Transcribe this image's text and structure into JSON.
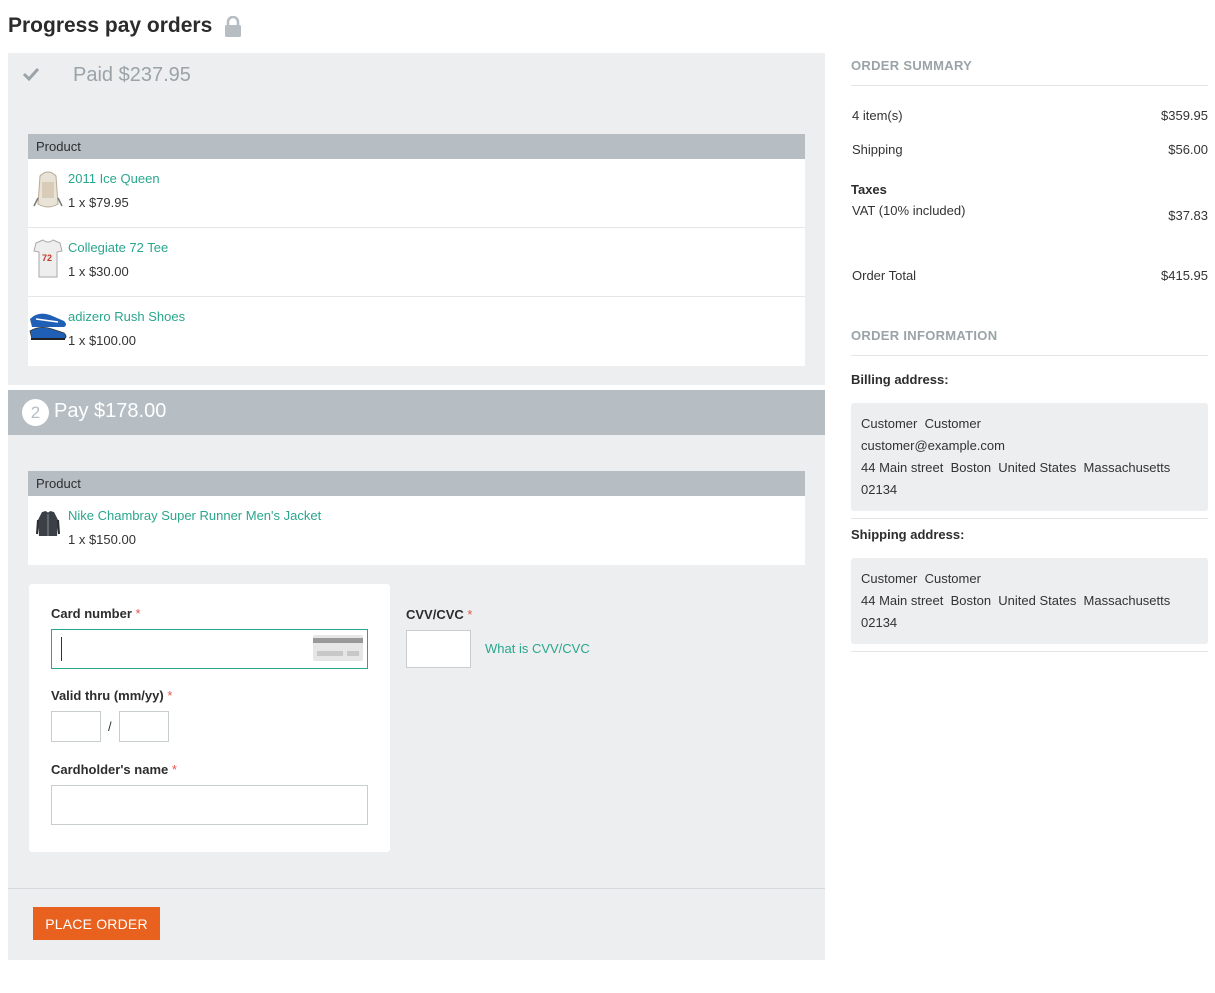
{
  "page": {
    "title": "Progress pay orders",
    "lock_icon": "lock-icon"
  },
  "paid": {
    "icon": "check-icon",
    "label": "Paid $237.95",
    "table_header": "Product",
    "products": [
      {
        "name": "2011 Ice Queen",
        "qty": "1 x $79.95",
        "thumb_icon": "backpack-thumbnail"
      },
      {
        "name": "Collegiate 72 Tee",
        "qty": "1 x $30.00",
        "thumb_icon": "tshirt-thumbnail"
      },
      {
        "name": "adizero Rush Shoes",
        "qty": "1 x $100.00",
        "thumb_icon": "shoe-thumbnail"
      }
    ]
  },
  "pay": {
    "step": "2",
    "label": "Pay $178.00",
    "table_header": "Product",
    "products": [
      {
        "name": "Nike Chambray Super Runner Men's Jacket",
        "qty": "1 x $150.00",
        "thumb_icon": "jacket-thumbnail"
      }
    ],
    "form": {
      "card_number_label": "Card number",
      "card_number_value": "",
      "valid_thru_label": "Valid thru (mm/yy)",
      "valid_separator": "/",
      "cardholder_label": "Cardholder's name",
      "cvv_label": "CVV/CVC",
      "cvv_link": "What is CVV/CVC",
      "required_mark": "*"
    },
    "place_order": "PLACE ORDER"
  },
  "summary": {
    "title": "ORDER SUMMARY",
    "items_label": "4 item(s)",
    "items_value": "$359.95",
    "shipping_label": "Shipping",
    "shipping_value": "$56.00",
    "taxes_title": "Taxes",
    "vat_label": "VAT (10% included)",
    "vat_value": "$37.83",
    "total_label": "Order Total",
    "total_value": "$415.95"
  },
  "info": {
    "title": "ORDER INFORMATION",
    "billing_label": "Billing address:",
    "billing_lines": [
      "Customer  Customer",
      "customer@example.com",
      "44 Main street  Boston  United States  Massachusetts",
      "02134"
    ],
    "shipping_label": "Shipping address:",
    "shipping_lines": [
      "Customer  Customer",
      "44 Main street  Boston  United States  Massachusetts",
      "02134"
    ]
  },
  "colors": {
    "accent_green": "#2aa68e",
    "place_order_orange": "#e8611f",
    "panel_gray": "#eceeef",
    "header_gray": "#b6bec4"
  }
}
